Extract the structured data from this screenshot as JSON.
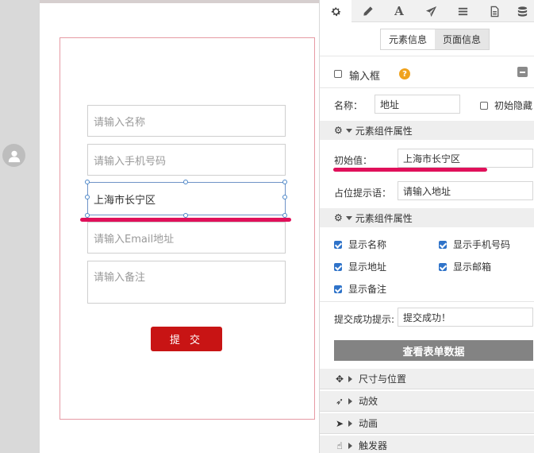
{
  "form": {
    "name_placeholder": "请输入名称",
    "phone_placeholder": "请输入手机号码",
    "address_value": "上海市长宁区",
    "email_placeholder": "请输入Email地址",
    "note_placeholder": "请输入备注",
    "submit_label": "提 交"
  },
  "panel": {
    "tabs": [
      "settings-icon",
      "pencil-icon",
      "text-icon",
      "send-icon",
      "list-icon",
      "file-icon",
      "database-icon"
    ],
    "tab_text_glyph": "A",
    "info_toggle": {
      "element_info": "元素信息",
      "page_info": "页面信息"
    },
    "element_type": "输入框",
    "help_glyph": "?",
    "name_label": "名称：",
    "name_value": "地址",
    "hide_initially": "初始隐藏",
    "section_component_props": "元素组件属性",
    "initial_value_label": "初始值：",
    "initial_value": "上海市长宁区",
    "placeholder_label": "占位提示语：",
    "placeholder_value": "请输入地址",
    "section_component_props_2": "元素组件属性",
    "options": [
      {
        "label": "显示名称",
        "checked": true
      },
      {
        "label": "显示手机号码",
        "checked": true
      },
      {
        "label": "显示地址",
        "checked": true
      },
      {
        "label": "显示邮箱",
        "checked": true
      },
      {
        "label": "显示备注",
        "checked": true
      }
    ],
    "success_label": "提交成功提示:",
    "success_value": "提交成功！",
    "view_data_button": "查看表单数据",
    "accordions": {
      "size_position": "尺寸与位置",
      "effects": "动效",
      "animation": "动画",
      "trigger": "触发器"
    }
  },
  "colors": {
    "submit_bg": "#c81414",
    "highlight": "#e0105a",
    "checkbox": "#2f73c9",
    "help_icon": "#f0a21c"
  }
}
